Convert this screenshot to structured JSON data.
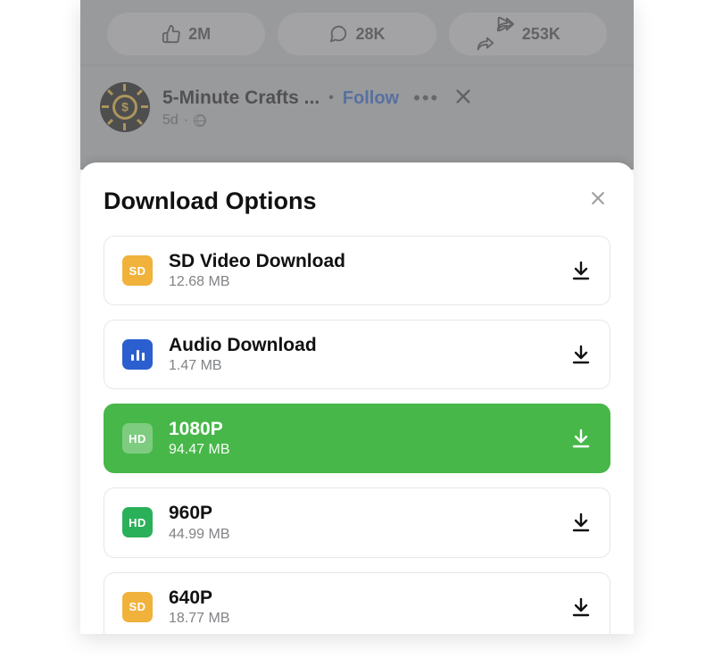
{
  "engagement": {
    "likes": "2M",
    "comments": "28K",
    "shares": "253K"
  },
  "post": {
    "page_name": "5-Minute Crafts ...",
    "follow_label": "Follow",
    "age": "5d"
  },
  "sheet": {
    "title": "Download Options"
  },
  "options": [
    {
      "badge_type": "sd",
      "badge_text": "SD",
      "label": "SD Video Download",
      "size": "12.68 MB",
      "selected": false
    },
    {
      "badge_type": "audio",
      "badge_text": "",
      "label": "Audio Download",
      "size": "1.47 MB",
      "selected": false
    },
    {
      "badge_type": "hd",
      "badge_text": "HD",
      "label": "1080P",
      "size": "94.47 MB",
      "selected": true
    },
    {
      "badge_type": "hd",
      "badge_text": "HD",
      "label": "960P",
      "size": "44.99 MB",
      "selected": false
    },
    {
      "badge_type": "sd",
      "badge_text": "SD",
      "label": "640P",
      "size": "18.77 MB",
      "selected": false
    }
  ]
}
